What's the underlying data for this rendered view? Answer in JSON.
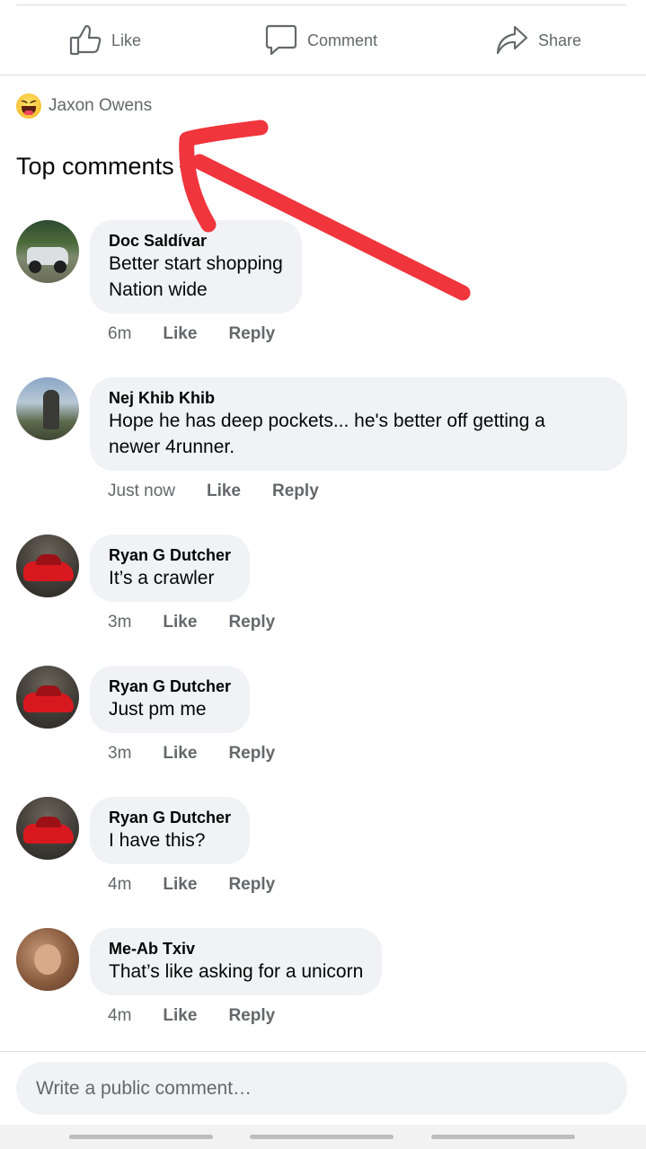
{
  "actions": {
    "like": "Like",
    "comment": "Comment",
    "share": "Share"
  },
  "reactions": {
    "icon": "haha-emoji-icon",
    "names": "Jaxon Owens"
  },
  "section": {
    "title": "Top comments"
  },
  "comments": [
    {
      "author": "Doc Saldívar",
      "lines": [
        "Better start shopping",
        "Nation wide"
      ],
      "time": "6m",
      "like": "Like",
      "reply": "Reply"
    },
    {
      "author": "Nej Khib Khib",
      "lines": [
        "Hope he has deep pockets... he's better off getting a",
        "newer 4runner."
      ],
      "time": "Just now",
      "like": "Like",
      "reply": "Reply"
    },
    {
      "author": "Ryan G Dutcher",
      "lines": [
        "It’s a crawler"
      ],
      "time": "3m",
      "like": "Like",
      "reply": "Reply"
    },
    {
      "author": "Ryan G Dutcher",
      "lines": [
        "Just pm me"
      ],
      "time": "3m",
      "like": "Like",
      "reply": "Reply"
    },
    {
      "author": "Ryan G Dutcher",
      "lines": [
        "I have this?"
      ],
      "time": "4m",
      "like": "Like",
      "reply": "Reply"
    },
    {
      "author": "Me-Ab Txiv",
      "lines": [
        "That’s like asking for a unicorn"
      ],
      "time": "4m",
      "like": "Like",
      "reply": "Reply"
    }
  ],
  "composer": {
    "placeholder": "Write a public comment…"
  },
  "colors": {
    "bubble": "#f0f2f5",
    "muted_text": "#65676b",
    "annotation_arrow": "#f0353d"
  }
}
